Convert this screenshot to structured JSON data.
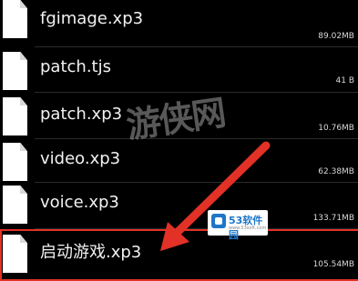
{
  "files": [
    {
      "name": "fgimage.xp3",
      "size": "89.02MB"
    },
    {
      "name": "patch.tjs",
      "size": "41 B"
    },
    {
      "name": "patch.xp3",
      "size": "10.76MB"
    },
    {
      "name": "video.xp3",
      "size": "62.38MB"
    },
    {
      "name": "voice.xp3",
      "size": "133.71MB"
    },
    {
      "name": "启动游戏.xp3",
      "size": "105.54MB"
    }
  ],
  "watermark": "游侠网",
  "logo": {
    "brand": "53软件园",
    "url": "www.53soft.com"
  },
  "colors": {
    "background": "#000000",
    "highlight": "#e23126",
    "text": "#f2f2f2"
  }
}
